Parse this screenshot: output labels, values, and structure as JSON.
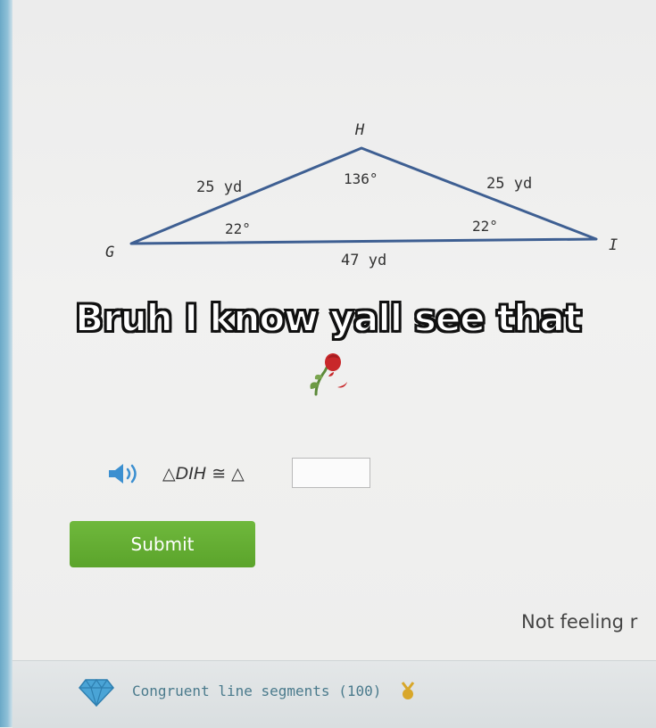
{
  "diagram": {
    "vertices": {
      "top": "H",
      "left": "G",
      "right": "I"
    },
    "sides": {
      "gh": "25 yd",
      "hi": "25 yd",
      "gi": "47 yd"
    },
    "angles": {
      "h": "136°",
      "g": "22°",
      "i": "22°"
    },
    "stroke_color": "#3e5f92"
  },
  "caption": "Bruh I know yall see that",
  "emoji_name": "wilted-rose",
  "question": {
    "prefix": "△",
    "triangle": "DIH",
    "symbol": "≅",
    "suffix": "△",
    "answer_value": ""
  },
  "submit_label": "Submit",
  "not_feeling_label": "Not feeling r",
  "footer": {
    "skill_label": "Congruent line segments (100)",
    "gem_icon": "diamond-icon",
    "medal_icon": "medal-icon"
  },
  "colors": {
    "submit_green": "#5ba42b",
    "speaker_blue": "#3b8fd0",
    "gem_blue": "#4aa4d6",
    "medal_gold": "#d8a72a"
  }
}
